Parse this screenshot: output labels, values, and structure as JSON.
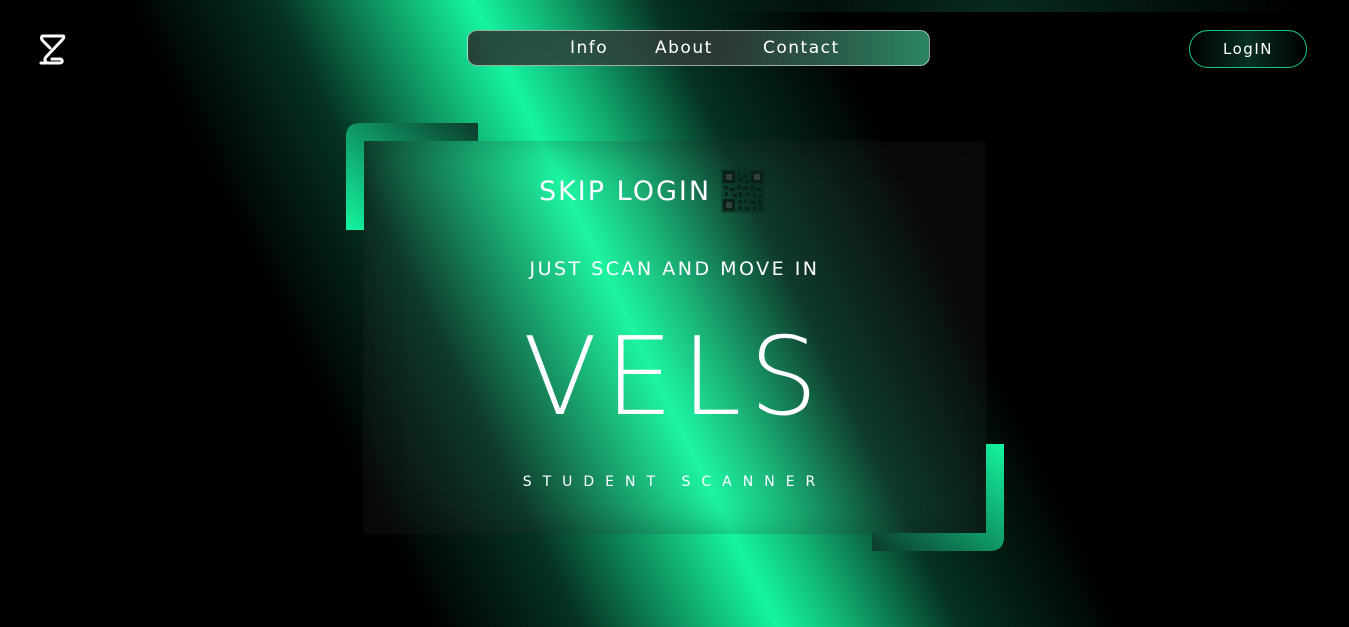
{
  "header": {
    "logo_icon": "hourglass-s-logo-icon",
    "nav": {
      "items": [
        {
          "label": "Info"
        },
        {
          "label": "About"
        },
        {
          "label": "Contact"
        }
      ]
    },
    "login_label": "LogIN"
  },
  "hero": {
    "skip_label": "SKIP LOGIN",
    "qr_icon": "qr-code-icon",
    "tagline": "JUST SCAN AND MOVE IN",
    "brand": "VELS",
    "subtitle": "STUDENT SCANNER"
  },
  "colors": {
    "accent": "#14f5a0",
    "accent_dark": "#0a5a3c",
    "background": "#000000",
    "text": "#ffffff"
  }
}
